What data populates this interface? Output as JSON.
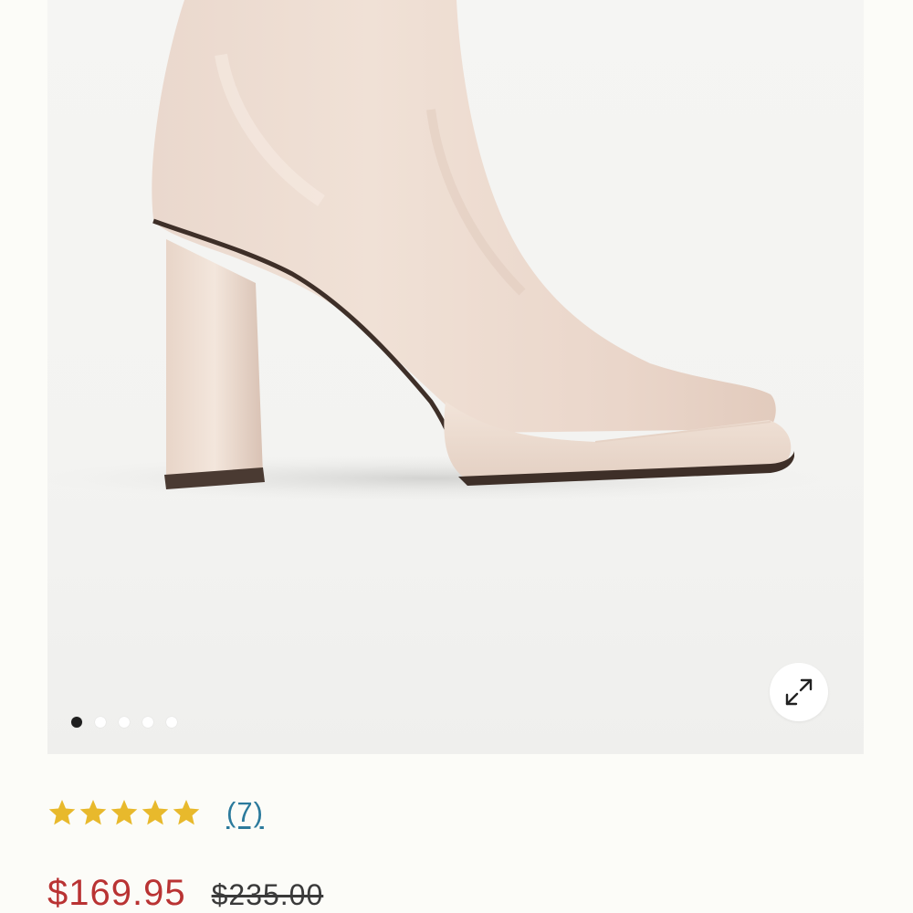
{
  "gallery": {
    "image_alt": "Cream square-toe platform heeled ankle boot",
    "slide_count": 5,
    "active_slide": 1,
    "expand_icon": "expand-arrows-icon"
  },
  "rating": {
    "stars": 5,
    "star_icon": "star-icon",
    "star_color": "#e8b92c",
    "review_count_label": "(7)",
    "link_color": "#2b7a9c"
  },
  "price": {
    "sale": "$169.95",
    "original": "$235.00",
    "sale_color": "#b93333"
  }
}
